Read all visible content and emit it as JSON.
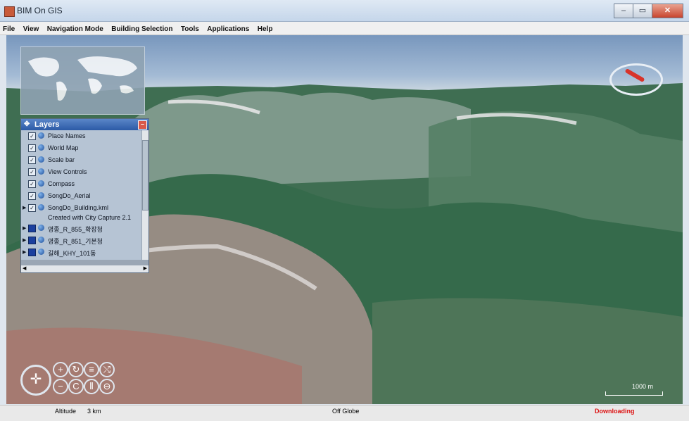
{
  "window": {
    "title": "BIM On GIS",
    "minimize": "–",
    "maximize": "▭",
    "close": "✕"
  },
  "menu": [
    "File",
    "View",
    "Navigation Mode",
    "Building Selection",
    "Tools",
    "Applications",
    "Help"
  ],
  "layers_panel": {
    "title": "Layers",
    "minimize_glyph": "–",
    "items": [
      {
        "label": "Place Names",
        "checked": true
      },
      {
        "label": "World Map",
        "checked": true
      },
      {
        "label": "Scale bar",
        "checked": true
      },
      {
        "label": "View Controls",
        "checked": true
      },
      {
        "label": "Compass",
        "checked": true
      },
      {
        "label": "SongDo_Aerial",
        "checked": true
      },
      {
        "label": "SongDo_Building.kml",
        "checked": true,
        "expandable": true,
        "sub": "Created with City Capture 2.1"
      },
      {
        "label": "영종_R_855_확장청",
        "checked": false,
        "expandable": true
      },
      {
        "label": "영종_R_851_기본청",
        "checked": false,
        "expandable": true
      },
      {
        "label": "길해_KHY_101동",
        "checked": false,
        "expandable": true
      }
    ],
    "scroll_left": "◀",
    "scroll_right": "▶"
  },
  "nav_controls": {
    "pan": "✛",
    "zoom_in": "+",
    "zoom_out": "−",
    "rotate_left": "↻",
    "rotate_right": "C",
    "tilt_up": "≡",
    "tilt_down": "⦀",
    "vertical": "⤭",
    "reset": "⊖"
  },
  "scale_bar": {
    "label": "1000 m"
  },
  "status": {
    "altitude_label": "Altitude",
    "altitude_value": "3 km",
    "globe_status": "Off Globe",
    "download_status": "Downloading"
  },
  "colors": {
    "download": "#d11111",
    "layers_header": "#2c5aa6",
    "compass_needle": "#d8332a"
  }
}
